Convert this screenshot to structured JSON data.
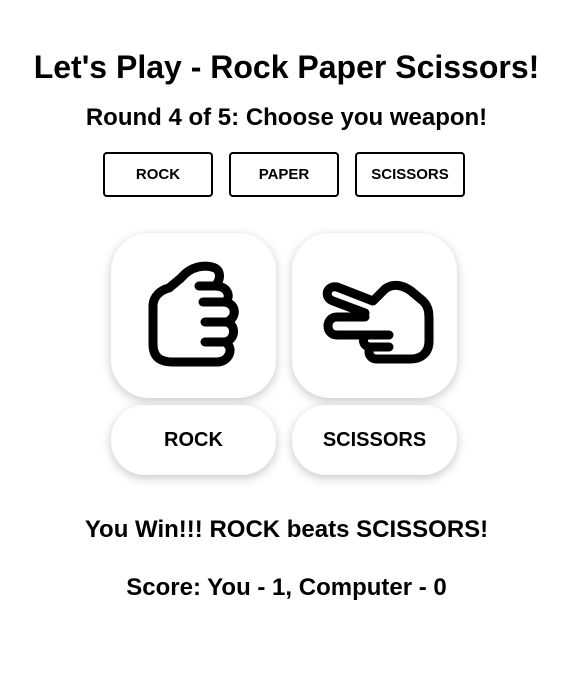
{
  "header": {
    "title": "Let's Play - Rock Paper Scissors!",
    "round_prompt": "Round 4 of 5: Choose you weapon!"
  },
  "weapons": [
    {
      "label": "ROCK"
    },
    {
      "label": "PAPER"
    },
    {
      "label": "SCISSORS"
    }
  ],
  "player": {
    "choice_icon": "rock-fist-icon",
    "choice_label": "ROCK"
  },
  "computer": {
    "choice_icon": "scissors-hand-icon",
    "choice_label": "SCISSORS"
  },
  "result": {
    "message": "You Win!!! ROCK beats SCISSORS!",
    "score": "Score: You - 1, Computer - 0"
  }
}
